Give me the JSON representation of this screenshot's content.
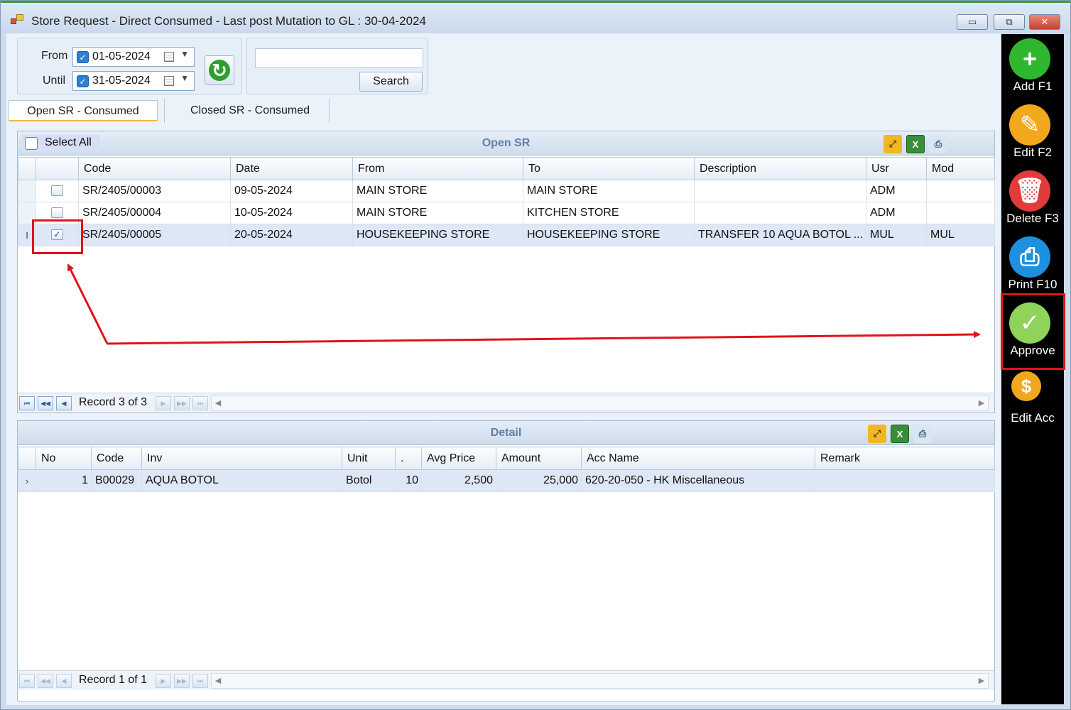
{
  "window": {
    "title": "Store Request - Direct Consumed - Last post Mutation to GL : 30-04-2024",
    "minimize": "▭",
    "restore": "⧉",
    "close": "✕"
  },
  "filter": {
    "from_label": "From",
    "from_value": "01-05-2024",
    "until_label": "Until",
    "until_value": "31-05-2024",
    "search_placeholder": "",
    "search_button": "Search"
  },
  "tabs": [
    {
      "label": "Open SR - Consumed",
      "active": true
    },
    {
      "label": "Closed SR - Consumed",
      "active": false
    }
  ],
  "open_sr": {
    "title": "Open SR",
    "select_all": "Select All",
    "columns": [
      "Code",
      "Date",
      "From",
      "To",
      "Description",
      "Usr",
      "Mod"
    ],
    "rows": [
      {
        "checked": false,
        "code": "SR/2405/00003",
        "date": "09-05-2024",
        "from": "MAIN STORE",
        "to": "MAIN STORE",
        "description": "",
        "usr": "ADM",
        "mod": ""
      },
      {
        "checked": false,
        "code": "SR/2405/00004",
        "date": "10-05-2024",
        "from": "MAIN STORE",
        "to": "KITCHEN STORE",
        "description": "",
        "usr": "ADM",
        "mod": ""
      },
      {
        "checked": true,
        "code": "SR/2405/00005",
        "date": "20-05-2024",
        "from": "HOUSEKEEPING STORE",
        "to": "HOUSEKEEPING STORE",
        "description": "TRANSFER 10 AQUA BOTOL ...",
        "usr": "MUL",
        "mod": "MUL"
      }
    ],
    "record_text": "Record 3 of 3"
  },
  "detail": {
    "title": "Detail",
    "columns": [
      "No",
      "Code",
      "Inv",
      "Unit",
      ".",
      "Avg Price",
      "Amount",
      "Acc Name",
      "Remark"
    ],
    "rows": [
      {
        "no": "1",
        "code": "B00029",
        "inv": "AQUA BOTOL",
        "unit": "Botol",
        "qty": "10",
        "avg_price": "2,500",
        "amount": "25,000",
        "acc_name": "620-20-050 - HK Miscellaneous",
        "remark": ""
      }
    ],
    "record_text": "Record 1 of 1"
  },
  "sidebar": [
    {
      "label": "Add F1",
      "icon": "plus-icon",
      "glyph": "+",
      "color": "#2fb82f"
    },
    {
      "label": "Edit F2",
      "icon": "edit-icon",
      "glyph": "✎",
      "color": "#f2a81c"
    },
    {
      "label": "Delete F3",
      "icon": "trash-icon",
      "glyph": "🗑",
      "color": "#e23b3b"
    },
    {
      "label": "Print F10",
      "icon": "printer-icon",
      "glyph": "⎙",
      "color": "#1e90e0"
    },
    {
      "label": "Approve",
      "icon": "check-icon",
      "glyph": "✓",
      "color": "#8fd35a"
    },
    {
      "label": "Edit Acc",
      "icon": "dollar-icon",
      "glyph": "$",
      "color": "#f2a81c"
    }
  ]
}
